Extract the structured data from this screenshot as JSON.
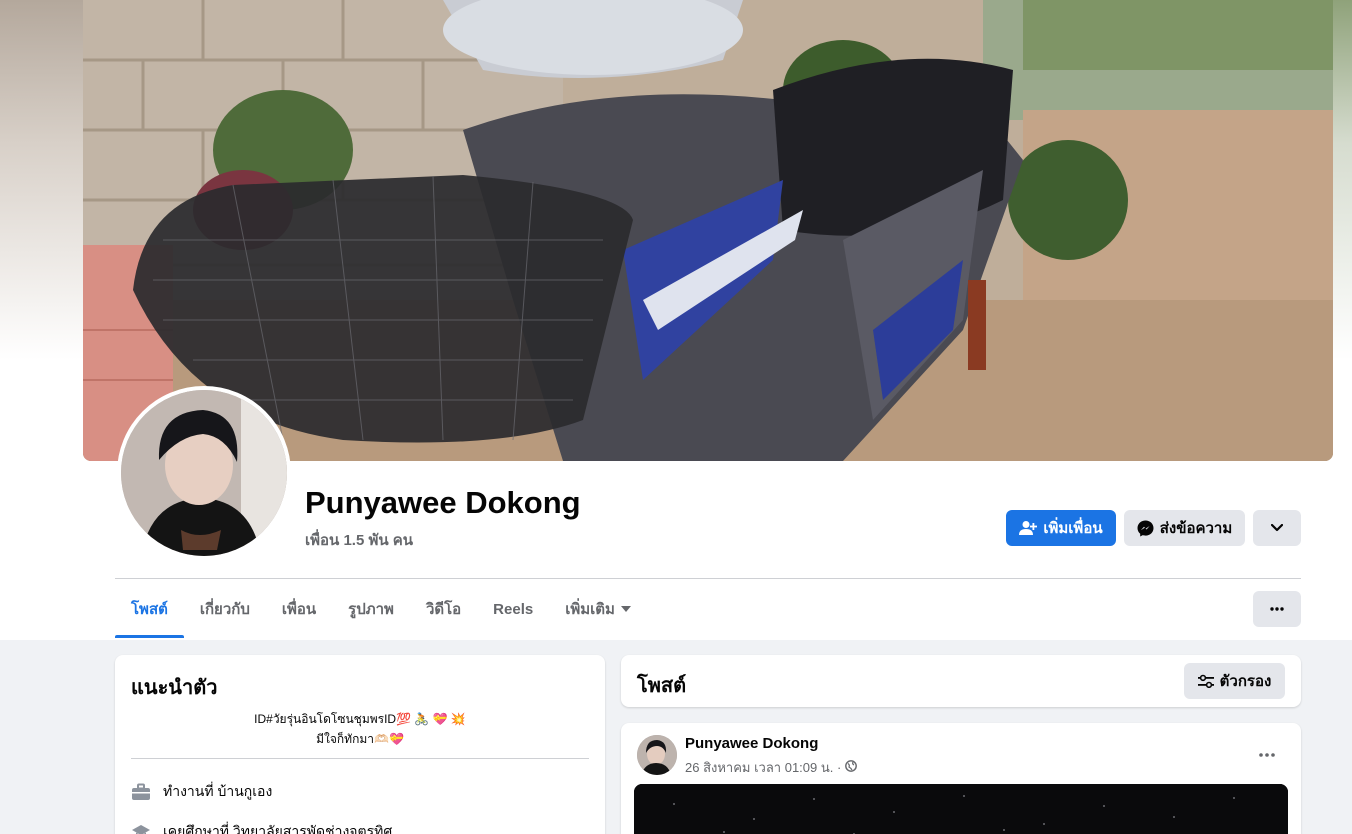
{
  "profile": {
    "name": "Punyawee Dokong",
    "friends_count": "เพื่อน 1.5 พัน คน"
  },
  "actions": {
    "add_friend": "เพิ่มเพื่อน",
    "message": "ส่งข้อความ"
  },
  "tabs": [
    {
      "label": "โพสต์",
      "active": true
    },
    {
      "label": "เกี่ยวกับ",
      "active": false
    },
    {
      "label": "เพื่อน",
      "active": false
    },
    {
      "label": "รูปภาพ",
      "active": false
    },
    {
      "label": "วิดีโอ",
      "active": false
    },
    {
      "label": "Reels",
      "active": false
    },
    {
      "label": "เพิ่มเติม",
      "active": false
    }
  ],
  "intro": {
    "title": "แนะนำตัว",
    "bio_line1": "ID#วัยรุ่นอินโดโซนชุมพรID💯 🚴 💝 💥",
    "bio_line2": "มีใจก็ทักมา🫶🏻💝",
    "work": "ทำงานที่ บ้านกูเอง",
    "education": "เคยศึกษาที่ วิทยาลัยสารพัดช่างจตุรทิศ"
  },
  "posts": {
    "title": "โพสต์",
    "filter_label": "ตัวกรอง",
    "first_post": {
      "author": "Punyawee Dokong",
      "date": "26 สิงหาคม เวลา 01:09 น. ·"
    }
  },
  "colors": {
    "accent": "#1b74e4",
    "secondary_button": "#e4e6eb",
    "page_bg": "#f0f2f5"
  },
  "icons": {
    "add_friend": "person-plus-icon",
    "message": "messenger-icon",
    "dropdown": "chevron-down-icon",
    "more": "more-dots-icon",
    "filter": "filter-sliders-icon",
    "work": "briefcase-icon",
    "education": "graduation-cap-icon",
    "privacy": "globe-icon"
  }
}
